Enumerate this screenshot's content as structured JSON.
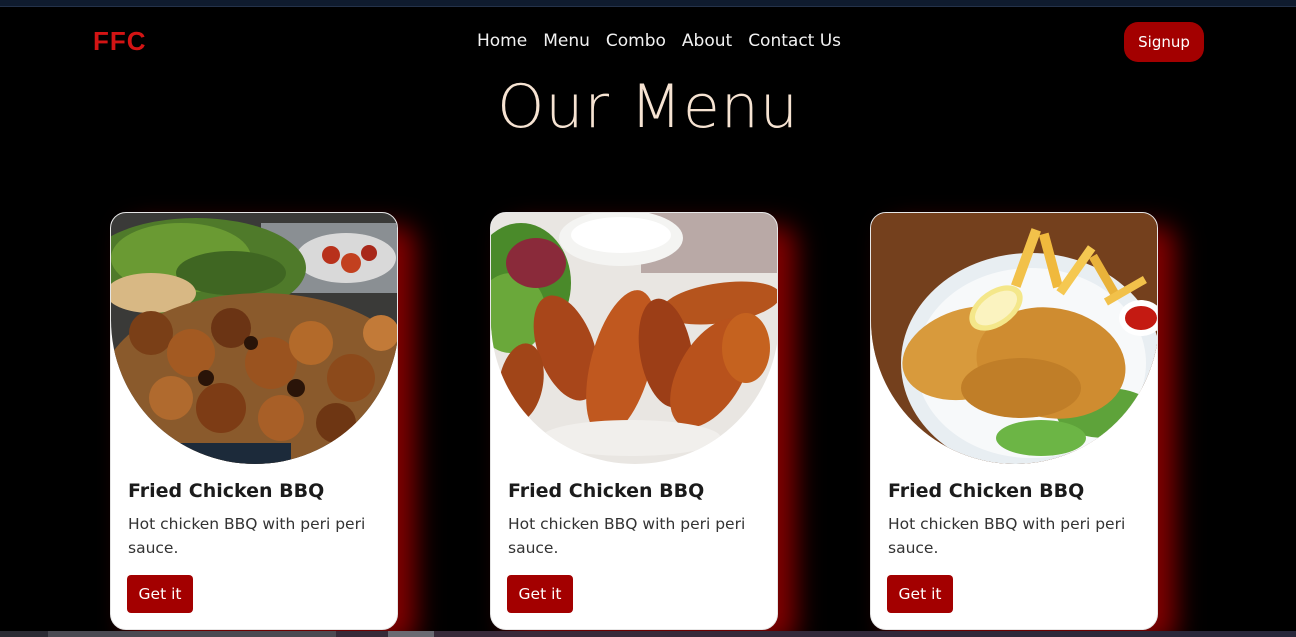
{
  "brand": {
    "logo": "FFC"
  },
  "nav": {
    "items": [
      {
        "label": "Home"
      },
      {
        "label": "Menu"
      },
      {
        "label": "Combo"
      },
      {
        "label": "About"
      },
      {
        "label": "Contact Us"
      }
    ],
    "signup_label": "Signup"
  },
  "page": {
    "title": "Our Menu"
  },
  "cards": [
    {
      "name": "Fried Chicken BBQ",
      "description": "Hot chicken BBQ with peri peri sauce.",
      "button": "Get it",
      "image": "grilled-chicken-wings-image"
    },
    {
      "name": "Fried Chicken BBQ",
      "description": "Hot chicken BBQ with peri peri sauce.",
      "button": "Get it",
      "image": "fried-chicken-strips-image"
    },
    {
      "name": "Fried Chicken BBQ",
      "description": "Hot chicken BBQ with peri peri sauce.",
      "button": "Get it",
      "image": "breaded-cutlet-fries-image"
    }
  ],
  "colors": {
    "accent": "#a30000",
    "logo": "#d31414",
    "title": "#f6e3d2",
    "background": "#000000"
  }
}
